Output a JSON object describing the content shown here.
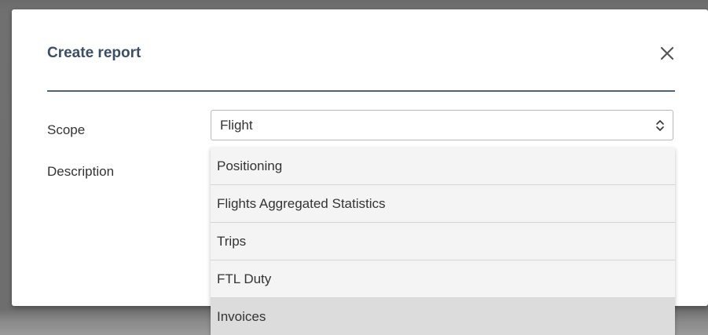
{
  "modal": {
    "title": "Create report",
    "close_icon": "close-icon"
  },
  "form": {
    "scope_label": "Scope",
    "description_label": "Description",
    "scope_select": {
      "value": "Flight",
      "arrow_icon": "chevron-up-down-icon"
    }
  },
  "dropdown": {
    "options": [
      {
        "label": "Positioning"
      },
      {
        "label": "Flights Aggregated Statistics"
      },
      {
        "label": "Trips"
      },
      {
        "label": "FTL Duty"
      },
      {
        "label": "Invoices"
      }
    ],
    "hovered_option": "Invoices"
  },
  "colors": {
    "title": "#3d4d64",
    "divider": "#4a6283",
    "overlay": "#6e6e6e",
    "dropdown_bg": "#f4f4f4",
    "hover_bg": "#dcdcdc"
  }
}
